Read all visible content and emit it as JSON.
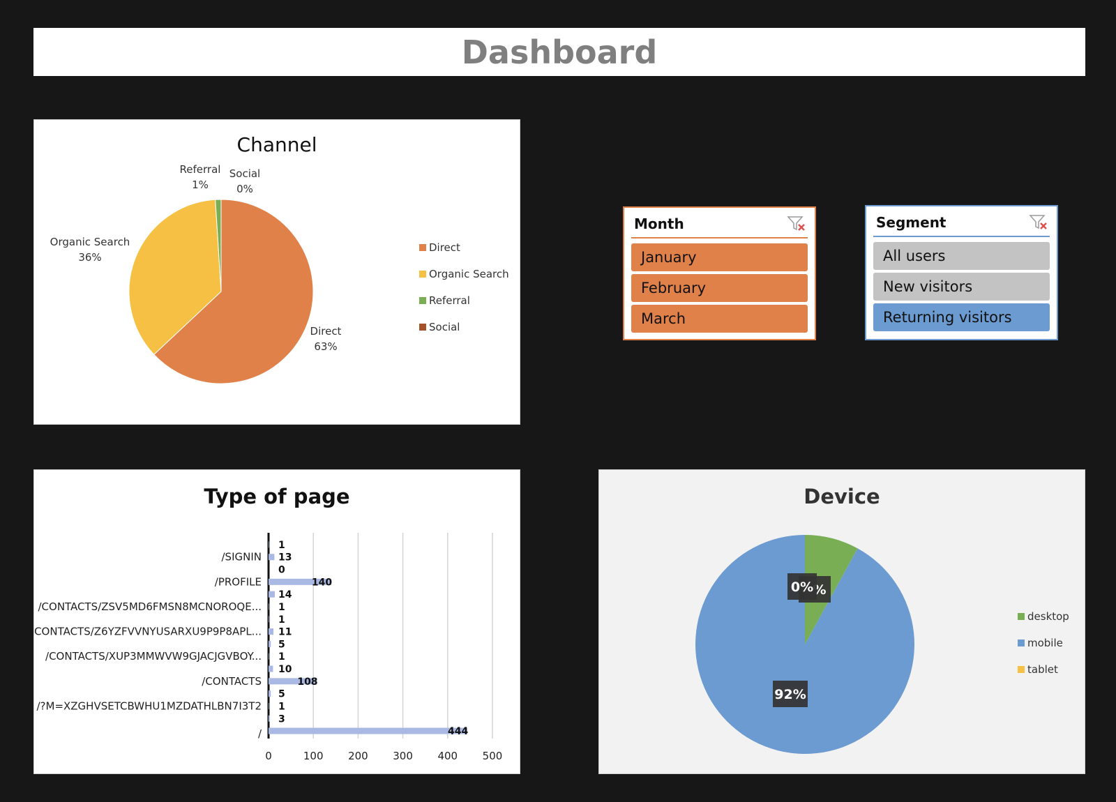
{
  "dashboard": {
    "title": "Dashboard"
  },
  "colors": {
    "background": "#171717",
    "orange": "#E0814A",
    "yellow": "#F5C043",
    "green": "#7AAE55",
    "brown": "#A5512A",
    "blue": "#6B9BD1",
    "bar": "#AAB9E3",
    "slicer_gray": "#C3C3C3"
  },
  "month_slicer": {
    "header": "Month",
    "accent": "#E0814A",
    "clear_icon": "clear-filter-icon",
    "items": [
      {
        "label": "January",
        "selected": true
      },
      {
        "label": "February",
        "selected": true
      },
      {
        "label": "March",
        "selected": true
      }
    ]
  },
  "segment_slicer": {
    "header": "Segment",
    "accent": "#6B9BD1",
    "clear_icon": "clear-filter-icon",
    "items": [
      {
        "label": "All users",
        "selected": false
      },
      {
        "label": "New visitors",
        "selected": false
      },
      {
        "label": "Returning visitors",
        "selected": true
      }
    ]
  },
  "chart_data": [
    {
      "type": "pie",
      "title": "Channel",
      "slices": [
        {
          "name": "Direct",
          "value": 63,
          "label": "63%",
          "color": "#E0814A"
        },
        {
          "name": "Organic Search",
          "value": 36,
          "label": "36%",
          "color": "#F5C043"
        },
        {
          "name": "Referral",
          "value": 1,
          "label": "1%",
          "color": "#7AAE55"
        },
        {
          "name": "Social",
          "value": 0,
          "label": "0%",
          "color": "#A5512A"
        }
      ],
      "legend": [
        "Direct",
        "Organic Search",
        "Referral",
        "Social"
      ],
      "legend_position": "right"
    },
    {
      "type": "bar",
      "orientation": "horizontal",
      "title": "Type of page",
      "categories": [
        "/SIGNIN",
        "/PROFILE",
        "/CONTACTS/ZSV5MD6FMSN8MCNOROQE...",
        "/CONTACTS/Z6YZFVVNYUSARXU9P9P8APL...",
        "/CONTACTS/XUP3MMWVW9GJACJGVBOY...",
        "/CONTACTS",
        "/?M=XZGHVSETCBWHU1MZDATHLBN7I3T2",
        "/"
      ],
      "values": [
        1,
        13,
        0,
        140,
        14,
        1,
        1,
        11,
        5,
        1,
        10,
        108,
        5,
        1,
        3,
        444
      ],
      "xlim": [
        0,
        500
      ],
      "xticks": [
        0,
        100,
        200,
        300,
        400,
        500
      ],
      "grid": true,
      "bar_color": "#AAB9E3"
    },
    {
      "type": "pie",
      "title": "Device",
      "slices": [
        {
          "name": "desktop",
          "value": 8,
          "label": "",
          "color": "#7AAE55"
        },
        {
          "name": "mobile",
          "value": 92,
          "label": "92%",
          "color": "#6B9BD1"
        },
        {
          "name": "tablet",
          "value": 0,
          "label": "0%",
          "color": "#F5C043"
        }
      ],
      "legend": [
        "desktop",
        "mobile",
        "tablet"
      ],
      "legend_position": "right",
      "overlap_label_text": "%",
      "background": "#F2F2F2"
    }
  ]
}
